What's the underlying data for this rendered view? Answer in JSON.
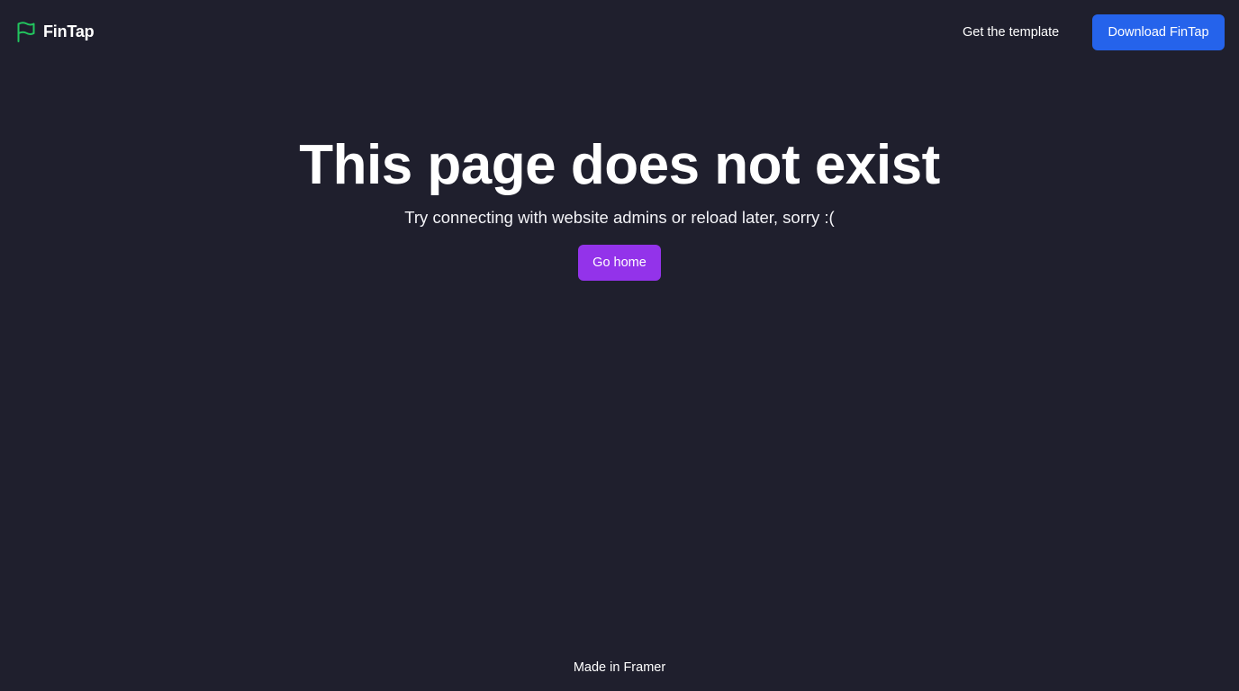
{
  "colors": {
    "background": "#1f1f2d",
    "brand_icon": "#22c55e",
    "download_button": "#2563eb",
    "home_button": "#9333ea",
    "text": "#ffffff"
  },
  "header": {
    "brand": {
      "icon": "flag-icon",
      "name": "FinTap"
    },
    "template_link": "Get the template",
    "download_button": "Download FinTap"
  },
  "main": {
    "title": "This page does not exist",
    "subtitle": "Try connecting with website admins or reload later, sorry :(",
    "home_button": "Go home"
  },
  "footer": {
    "credit": "Made in Framer"
  }
}
